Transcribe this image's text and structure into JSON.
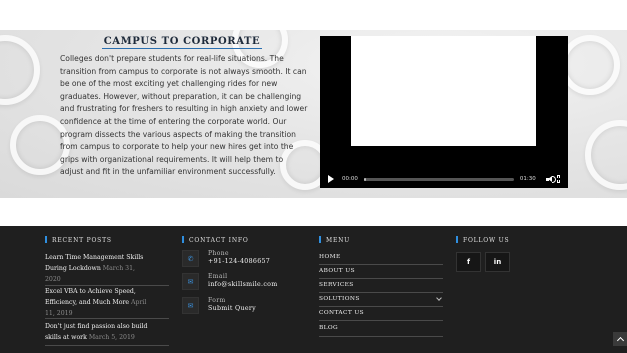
{
  "campus": {
    "title": "CAMPUS TO CORPORATE",
    "lines": [
      "Colleges don't prepare students for real-life situations. The",
      "transition from campus to corporate is not always smooth. It can",
      "be one of the most exciting yet challenging rides for new",
      "graduates. However, without preparation, it can be challenging",
      "and frustrating for freshers to resulting in high anxiety and lower",
      "confidence at the time of entering the corporate world. Our",
      "program dissects the various aspects of making the transition",
      "from campus to corporate to help your new hires get into the",
      "grips with organizational requirements. It will help them to",
      "adjust and fit in the unfamiliar environment successfully."
    ]
  },
  "video": {
    "current_time": "00:00",
    "duration": "01:30",
    "progress": 0.0
  },
  "footer": {
    "recent_posts": {
      "title": "RECENT POSTS",
      "posts": [
        {
          "title_line1": "Learn Time Management Skills",
          "title_line2": "During Lockdown",
          "date_inline": "March 31,",
          "date_line2": "2020"
        },
        {
          "title_line1": "Excel VBA to Achieve Speed,",
          "title_line2": "Efficiency, and Much More",
          "date_inline": "April",
          "date_line2": "11, 2019"
        },
        {
          "title_line1": "Don't just find passion also build",
          "title_line2": "skills at work",
          "date_inline": "March 5, 2019",
          "date_line2": ""
        }
      ]
    },
    "contact": {
      "title": "CONTACT INFO",
      "items": [
        {
          "label": "Phone",
          "value": "+91-124-4086657",
          "icon": "phone-icon"
        },
        {
          "label": "Email",
          "value": "info@skillsmile.com",
          "icon": "envelope-icon"
        },
        {
          "label": "Form",
          "value": "Submit Query",
          "icon": "envelope-icon"
        }
      ]
    },
    "menu": {
      "title": "MENU",
      "items": [
        "HOME",
        "ABOUT US",
        "SERVICES",
        "SOLUTIONS",
        "CONTACT US",
        "BLOG"
      ]
    },
    "follow": {
      "title": "FOLLOW US",
      "facebook": "f",
      "linkedin": "in"
    }
  },
  "colors": {
    "accent": "#2f8fe0",
    "footer_bg": "#1f1f1f"
  }
}
